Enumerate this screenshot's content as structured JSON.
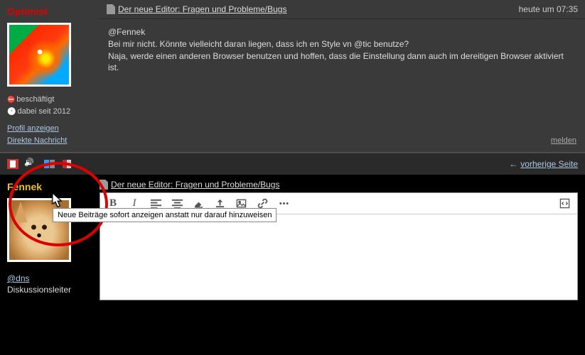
{
  "post1": {
    "username": "Optimist",
    "status_label": "beschäftigt",
    "since_label": "dabei seit 2012",
    "profile_link": "Profil anzeigen",
    "dm_link": "Direkte Nachricht",
    "thread_title": "Der neue Editor: Fragen und Probleme/Bugs",
    "timestamp": "heute um 07:35",
    "mention": "@Fennek",
    "line1": "Bei mir nicht. Könnte vielleicht daran liegen, dass ich en Style vn @tic benutze?",
    "line2": "Naja, werde einen anderen Browser benutzen und hoffen, dass die Einstellung dann auch im dereitigen Browser aktiviert ist.",
    "report": "melden"
  },
  "toolbar": {
    "prev_page": "vorherige Seite",
    "tooltip": "Neue Beiträge sofort anzeigen anstatt nur darauf hinzuweisen"
  },
  "post2": {
    "username": "Fennek",
    "tag": "@dns",
    "role": "Diskussionsleiter",
    "thread_title": "Der neue Editor: Fragen und Probleme/Bugs"
  }
}
